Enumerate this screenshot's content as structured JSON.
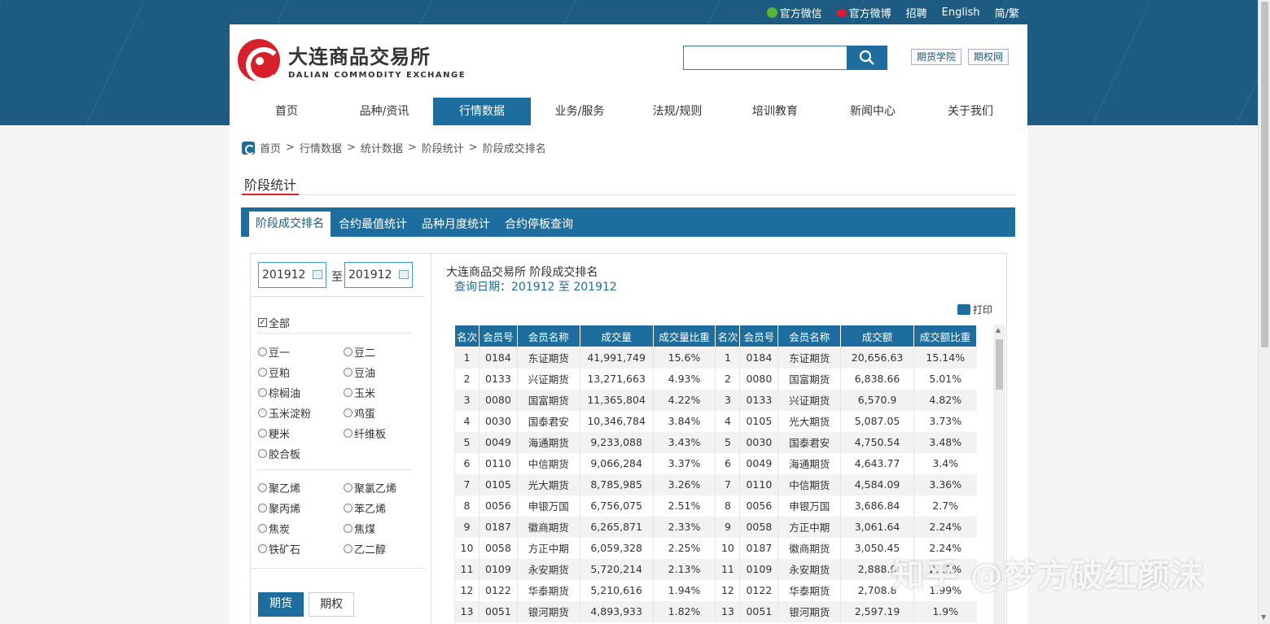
{
  "top_links": [
    {
      "label": "官方微信",
      "icon": "wechat-icon",
      "color": "#5cb531"
    },
    {
      "label": "官方微博",
      "icon": "weibo-icon",
      "color": "#e6162d"
    },
    {
      "label": "招聘"
    },
    {
      "label": "English"
    },
    {
      "label": "简/繁"
    }
  ],
  "logo": {
    "cn": "大连商品交易所",
    "en": "DALIAN COMMODITY EXCHANGE"
  },
  "search": {
    "value": "",
    "icon": "search-icon"
  },
  "header_buttons": [
    "期货学院",
    "期权网"
  ],
  "nav": [
    "首页",
    "品种/资讯",
    "行情数据",
    "业务/服务",
    "法规/规则",
    "培训教育",
    "新闻中心",
    "关于我们"
  ],
  "nav_active": 2,
  "breadcrumb": [
    "首页",
    ">",
    "行情数据",
    ">",
    "统计数据",
    ">",
    "阶段统计",
    ">",
    "阶段成交排名"
  ],
  "section_title": "阶段统计",
  "tabs": [
    "阶段成交排名",
    "合约最值统计",
    "品种月度统计",
    "合约停板查询"
  ],
  "filter": {
    "start": "201912",
    "to": "至",
    "end": "201912",
    "all_label": "全部",
    "group1": [
      "豆一",
      "豆二",
      "豆粕",
      "豆油",
      "棕榈油",
      "玉米",
      "玉米淀粉",
      "鸡蛋",
      "粳米",
      "纤维板",
      "胶合板"
    ],
    "group2": [
      "聚乙烯",
      "聚氯乙烯",
      "聚丙烯",
      "苯乙烯",
      "焦炭",
      "焦煤",
      "铁矿石",
      "乙二醇"
    ],
    "type_buttons": [
      "期货",
      "期权"
    ]
  },
  "result": {
    "title": "大连商品交易所 阶段成交排名",
    "date_line": "查询日期：201912 至 201912",
    "print_label": "打印"
  },
  "table": {
    "headers": [
      "名次",
      "会员号",
      "会员名称",
      "成交量",
      "成交量比重",
      "名次",
      "会员号",
      "会员名称",
      "成交额",
      "成交额比重"
    ],
    "rows": [
      [
        "1",
        "0184",
        "东证期货",
        "41,991,749",
        "15.6%",
        "1",
        "0184",
        "东证期货",
        "20,656.63",
        "15.14%"
      ],
      [
        "2",
        "0133",
        "兴证期货",
        "13,271,663",
        "4.93%",
        "2",
        "0080",
        "国富期货",
        "6,838.66",
        "5.01%"
      ],
      [
        "3",
        "0080",
        "国富期货",
        "11,365,804",
        "4.22%",
        "3",
        "0133",
        "兴证期货",
        "6,570.9",
        "4.82%"
      ],
      [
        "4",
        "0030",
        "国泰君安",
        "10,346,784",
        "3.84%",
        "4",
        "0105",
        "光大期货",
        "5,087.05",
        "3.73%"
      ],
      [
        "5",
        "0049",
        "海通期货",
        "9,233,088",
        "3.43%",
        "5",
        "0030",
        "国泰君安",
        "4,750.54",
        "3.48%"
      ],
      [
        "6",
        "0110",
        "中信期货",
        "9,066,284",
        "3.37%",
        "6",
        "0049",
        "海通期货",
        "4,643.77",
        "3.4%"
      ],
      [
        "7",
        "0105",
        "光大期货",
        "8,785,985",
        "3.26%",
        "7",
        "0110",
        "中信期货",
        "4,584.09",
        "3.36%"
      ],
      [
        "8",
        "0056",
        "申银万国",
        "6,756,075",
        "2.51%",
        "8",
        "0056",
        "申银万国",
        "3,686.84",
        "2.7%"
      ],
      [
        "9",
        "0187",
        "徽商期货",
        "6,265,871",
        "2.33%",
        "9",
        "0058",
        "方正中期",
        "3,061.64",
        "2.24%"
      ],
      [
        "10",
        "0058",
        "方正中期",
        "6,059,328",
        "2.25%",
        "10",
        "0187",
        "徽商期货",
        "3,050.45",
        "2.24%"
      ],
      [
        "11",
        "0109",
        "永安期货",
        "5,720,214",
        "2.13%",
        "11",
        "0109",
        "永安期货",
        "2,888.9",
        "2.12%"
      ],
      [
        "12",
        "0122",
        "华泰期货",
        "5,210,616",
        "1.94%",
        "12",
        "0122",
        "华泰期货",
        "2,708.8",
        "1.99%"
      ],
      [
        "13",
        "0051",
        "银河期货",
        "4,893,933",
        "1.82%",
        "13",
        "0051",
        "银河期货",
        "2,597.19",
        "1.9%"
      ]
    ]
  },
  "watermark": "知乎 @梦方破红颜沫"
}
